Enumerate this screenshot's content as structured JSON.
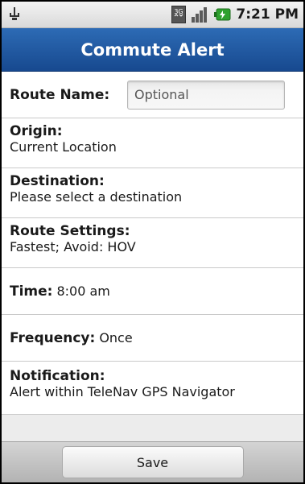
{
  "status_bar": {
    "time": "7:21 PM",
    "icons": [
      "usb-icon",
      "3g-icon",
      "signal-icon",
      "battery-icon"
    ],
    "network_label": "3G"
  },
  "header": {
    "title": "Commute Alert"
  },
  "form": {
    "route_name": {
      "label": "Route Name:",
      "value": "",
      "placeholder": "Optional"
    },
    "origin": {
      "label": "Origin:",
      "value": "Current Location"
    },
    "destination": {
      "label": "Destination:",
      "value": "Please select a destination"
    },
    "route_settings": {
      "label": "Route Settings:",
      "value": "Fastest; Avoid: HOV"
    },
    "time": {
      "label": "Time:",
      "value": "8:00 am"
    },
    "frequency": {
      "label": "Frequency:",
      "value": "Once"
    },
    "notification": {
      "label": "Notification:",
      "value": "Alert within TeleNav GPS Navigator"
    }
  },
  "footer": {
    "save_label": "Save"
  },
  "colors": {
    "title_bar": "#1f5aa3",
    "title_text": "#ffffff",
    "battery": "#2ea12e"
  }
}
